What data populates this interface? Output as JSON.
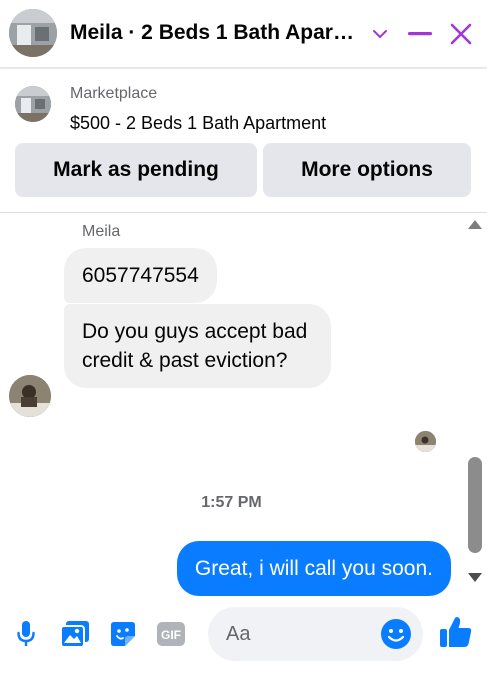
{
  "header": {
    "title": "Meila · 2 Beds 1 Bath Apartment",
    "chevron_icon": "chevron-down-icon",
    "minimize_icon": "minimize-icon",
    "close_icon": "close-icon",
    "accent_color": "#a335d6"
  },
  "listing": {
    "source": "Marketplace",
    "price_title": "$500 - 2 Beds 1 Bath Apartment",
    "buttons": {
      "mark_pending": "Mark as pending",
      "more_options": "More options"
    }
  },
  "conversation": {
    "sender_name": "Meila",
    "incoming": [
      "6057747554",
      "Do you guys accept bad credit & past eviction?"
    ],
    "timestamp": "1:57 PM",
    "outgoing": [
      "Great, i will call you soon."
    ],
    "outgoing_color": "#0a7cff"
  },
  "composer": {
    "placeholder": "Aa",
    "tools": [
      "microphone-icon",
      "photo-icon",
      "sticker-icon",
      "gif-icon"
    ],
    "gif_label": "GIF",
    "emoji_icon": "emoji-icon",
    "like_icon": "thumbs-up-icon",
    "icon_color": "#0a7cff"
  }
}
